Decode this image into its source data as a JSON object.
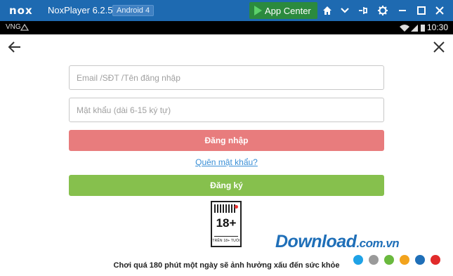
{
  "window": {
    "logo_text": "nox",
    "title": "NoxPlayer 6.2.5.0",
    "android_badge": "Android 4",
    "app_center_label": "App Center",
    "brand_color": "#1e6ab1",
    "icons": [
      "home-icon",
      "chevron-down-icon",
      "pin-icon",
      "gear-icon",
      "minimize-icon",
      "maximize-icon",
      "close-icon"
    ]
  },
  "statusbar": {
    "left_label": "VNG",
    "time": "10:30",
    "icons": [
      "wifi-icon",
      "signal-icon",
      "battery-icon"
    ]
  },
  "login": {
    "email_placeholder": "Email /SĐT /Tên đăng nhập",
    "password_placeholder": "Mật khẩu (dài 6-15 ký tự)",
    "login_label": "Đăng nhập",
    "forgot_label": "Quên mật khẩu?",
    "register_label": "Đăng ký",
    "login_color": "#e87c7d",
    "register_color": "#86c04d"
  },
  "age_rating": {
    "number": "18+",
    "caption": "TRÊN 18+ TUỔI"
  },
  "warning": "Chơi quá 180 phút một ngày sẽ ảnh hưởng xấu đến sức khỏe",
  "watermark": {
    "main": "Download",
    "domain": ".com.vn",
    "dot_colors": [
      "#1fa2e6",
      "#9a9a9a",
      "#6ab93e",
      "#f2a31d",
      "#1f6fb8",
      "#e12b2b"
    ]
  }
}
